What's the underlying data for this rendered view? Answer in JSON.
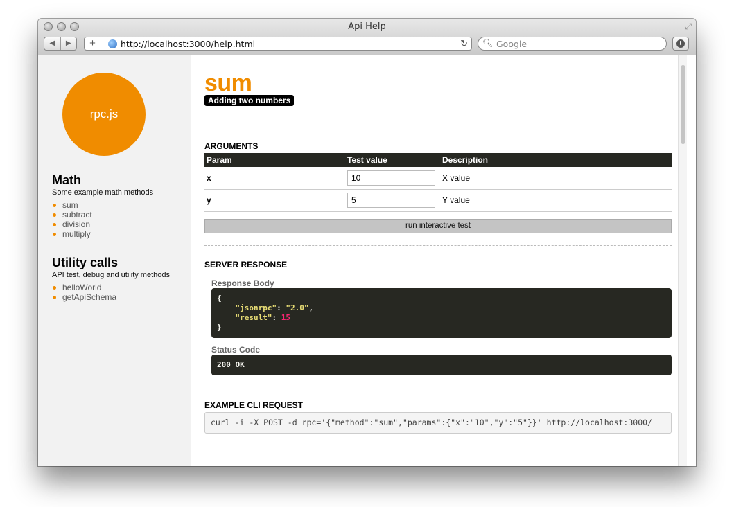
{
  "window": {
    "title": "Api Help"
  },
  "toolbar": {
    "back": "◀",
    "forward": "▶",
    "new_tab": "+",
    "url": "http://localhost:3000/help.html",
    "reload": "↻",
    "search_placeholder": "Google",
    "download": "⬇"
  },
  "sidebar": {
    "logo": "rpc.js",
    "groups": [
      {
        "title": "Math",
        "desc": "Some example math methods",
        "items": [
          "sum",
          "subtract",
          "division",
          "multiply"
        ]
      },
      {
        "title": "Utility calls",
        "desc": "API test, debug and utility methods",
        "items": [
          "helloWorld",
          "getApiSchema"
        ]
      }
    ]
  },
  "main": {
    "method_name": "sum",
    "method_desc": "Adding two numbers",
    "arguments_label": "ARGUMENTS",
    "columns": [
      "Param",
      "Test value",
      "Description"
    ],
    "args": [
      {
        "param": "x",
        "value": "10",
        "desc": "X value"
      },
      {
        "param": "y",
        "value": "5",
        "desc": "Y value"
      }
    ],
    "run_button": "run interactive test",
    "server_response_label": "SERVER RESPONSE",
    "response_body_label": "Response Body",
    "response": {
      "open": "{",
      "key1": "\"jsonrpc\"",
      "val1": "\"2.0\"",
      "key2": "\"result\"",
      "val2": "15",
      "close": "}"
    },
    "status_code_label": "Status Code",
    "status_code": "200 OK",
    "cli_label": "EXAMPLE CLI REQUEST",
    "cli_command": "curl -i -X POST -d rpc='{\"method\":\"sum\",\"params\":{\"x\":\"10\",\"y\":\"5\"}}' http://localhost:3000/"
  }
}
